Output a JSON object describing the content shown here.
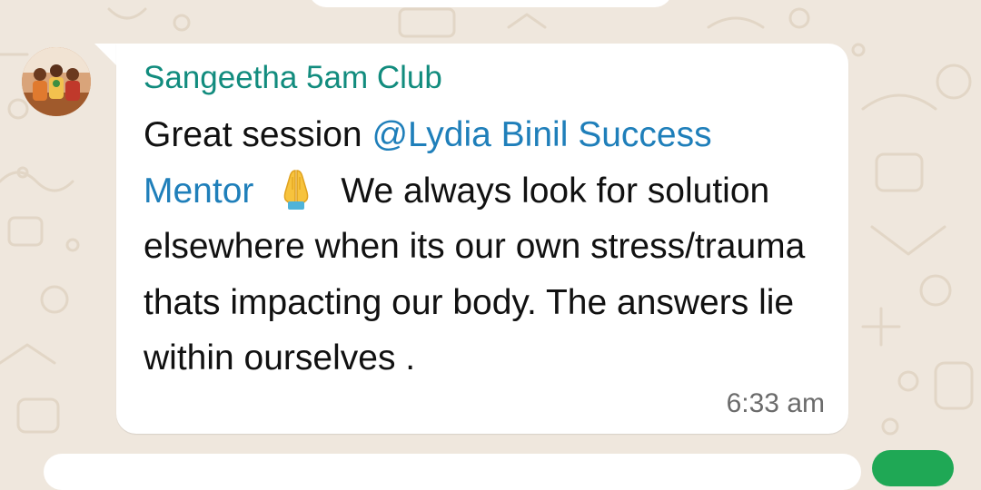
{
  "chat": {
    "message": {
      "sender_name": "Sangeetha 5am Club",
      "avatar_icon": "group-photo-avatar",
      "text_before_mention": "Great session ",
      "mention": "@Lydia Binil Success Mentor",
      "emoji": "folded-hands-emoji",
      "text_after_emoji": "We always look for solution elsewhere when its our own stress/trauma thats impacting our body. The answers lie within ourselves .",
      "timestamp": "6:33 am"
    }
  },
  "colors": {
    "wallpaper": "#efe7dd",
    "bubble": "#ffffff",
    "sender_name": "#128c7e",
    "mention": "#1f7fba",
    "message_text": "#111111",
    "timestamp": "#6b6b6b",
    "accent_fab": "#1fa855"
  }
}
